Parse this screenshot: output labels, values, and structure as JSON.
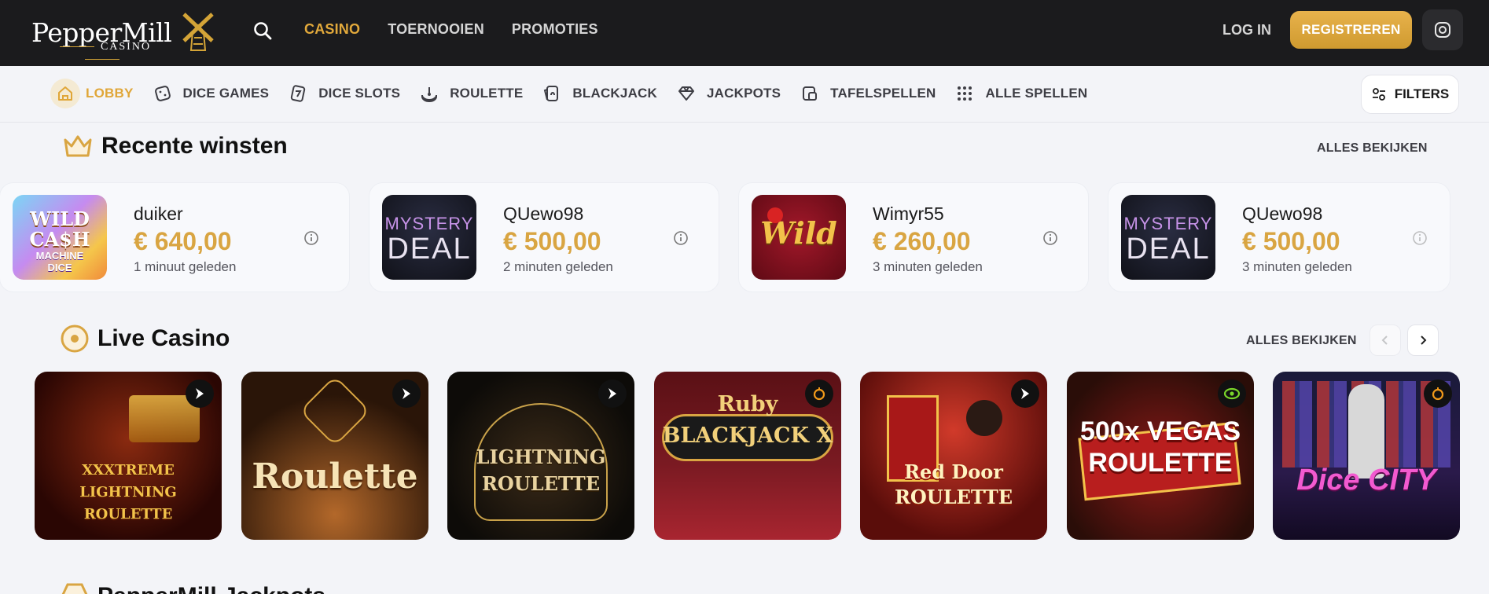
{
  "header": {
    "logo_text": "PepperMill",
    "logo_subtext": "CASINO",
    "nav": [
      "CASINO",
      "TOERNOOIEN",
      "PROMOTIES"
    ],
    "active_nav": "CASINO",
    "login_label": "LOG IN",
    "register_label": "REGISTREREN",
    "accent_color": "#e2a93b"
  },
  "categories": {
    "items": [
      {
        "label": "LOBBY",
        "icon": "home-icon",
        "active": true
      },
      {
        "label": "DICE GAMES",
        "icon": "dice-icon"
      },
      {
        "label": "DICE SLOTS",
        "icon": "dice-slot-icon"
      },
      {
        "label": "ROULETTE",
        "icon": "roulette-icon"
      },
      {
        "label": "BLACKJACK",
        "icon": "cards-icon"
      },
      {
        "label": "JACKPOTS",
        "icon": "diamond-icon"
      },
      {
        "label": "TAFELSPELLEN",
        "icon": "table-games-icon"
      },
      {
        "label": "ALLE SPELLEN",
        "icon": "grid-icon"
      }
    ],
    "filters_label": "FILTERS"
  },
  "recent_wins": {
    "title": "Recente winsten",
    "see_all": "ALLES BEKIJKEN",
    "items": [
      {
        "user": "duiker",
        "amount": "€ 640,00",
        "time": "1 minuut geleden",
        "game": "WILD CA$H MACHINE DICE"
      },
      {
        "user": "QUewo98",
        "amount": "€ 500,00",
        "time": "2 minuten geleden",
        "game": "MYSTERY DEAL"
      },
      {
        "user": "Wimyr55",
        "amount": "€ 260,00",
        "time": "3 minuten geleden",
        "game": "Wild"
      },
      {
        "user": "QUewo98",
        "amount": "€ 500,00",
        "time": "3 minuten geleden",
        "game": "MYSTERY DEAL"
      }
    ]
  },
  "live_casino": {
    "title": "Live Casino",
    "see_all": "ALLES BEKIJKEN",
    "games": [
      {
        "title": "XXXTREME LIGHTNING ROULETTE",
        "badge": "evolution"
      },
      {
        "title": "Roulette",
        "badge": "evolution"
      },
      {
        "title": "LIGHTNING ROULETTE",
        "badge": "evolution"
      },
      {
        "title": "Ruby BLACKJACK X",
        "badge": "pragmatic"
      },
      {
        "title": "Red Door ROULETTE",
        "badge": "evolution"
      },
      {
        "title": "500x VEGAS ROULETTE",
        "badge": "ezugi"
      },
      {
        "title": "Dice CITY",
        "badge": "pragmatic"
      }
    ]
  },
  "next_section": {
    "title": "PepperMill Jackpots"
  }
}
